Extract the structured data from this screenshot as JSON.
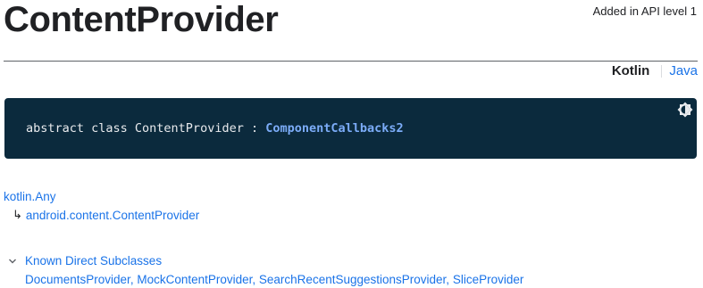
{
  "page": {
    "title": "ContentProvider",
    "api_level": "Added in API level 1"
  },
  "lang_switch": {
    "kotlin": "Kotlin",
    "java": "Java"
  },
  "signature": {
    "prefix": "abstract class ContentProvider : ",
    "link": "ComponentCallbacks2",
    "icon": "theme-toggle-icon"
  },
  "hierarchy": {
    "root": "kotlin.Any",
    "arrow": "↳",
    "child": "android.content.ContentProvider"
  },
  "subclasses": {
    "header": "Known Direct Subclasses",
    "items": [
      "DocumentsProvider",
      "MockContentProvider",
      "SearchRecentSuggestionsProvider",
      "SliceProvider"
    ]
  },
  "colors": {
    "link": "#1a73e8",
    "code_bg": "#0b2a3d",
    "code_link": "#7cacf8"
  }
}
